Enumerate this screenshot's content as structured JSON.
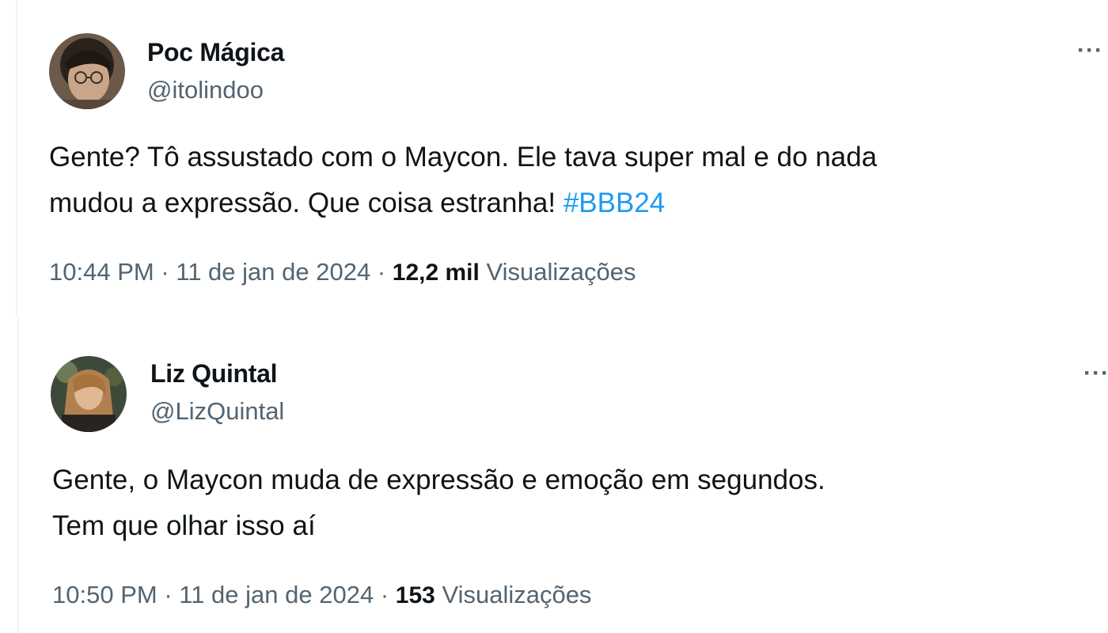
{
  "tweets": [
    {
      "display_name": "Poc Mágica",
      "handle": "@itolindoo",
      "text_line_1": "Gente? Tô assustado com o Maycon. Ele tava super mal e do nada",
      "text_line_2": "mudou a expressão. Que coisa estranha! ",
      "hashtag": "#BBB24",
      "time": "10:44 PM",
      "separator": " · ",
      "date": "11 de jan de 2024",
      "views_count": "12,2 mil",
      "views_label": "Visualizações",
      "more_icon": "more-horizontal-icon",
      "more_glyph": "···"
    },
    {
      "display_name": "Liz Quintal",
      "handle": "@LizQuintal",
      "text_line_1": "Gente, o Maycon muda de expressão e emoção em segundos.",
      "text_line_2": "Tem que olhar isso aí",
      "time": "10:50 PM",
      "separator": " · ",
      "date": "11 de jan de 2024",
      "views_count": "153",
      "views_label": "Visualizações",
      "more_icon": "more-horizontal-icon",
      "more_glyph": "···"
    }
  ],
  "colors": {
    "text_primary": "#0f1419",
    "text_secondary": "#536471",
    "link": "#1d9bf0",
    "divider": "#eff3f4"
  }
}
